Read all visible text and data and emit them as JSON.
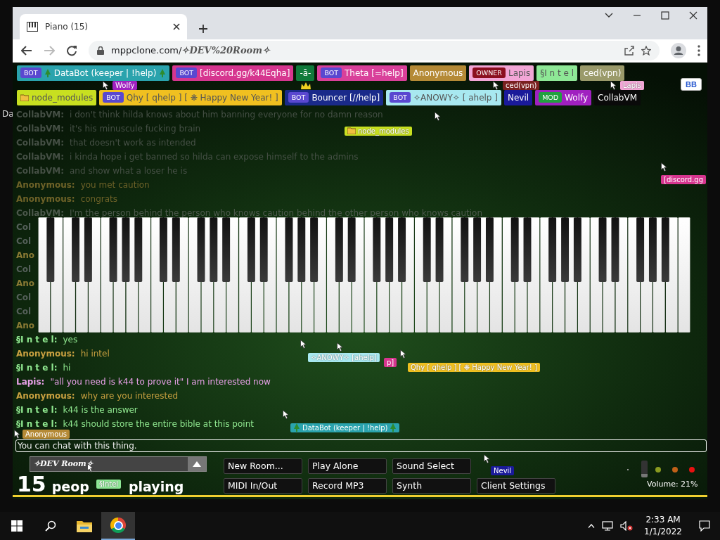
{
  "desktop": {
    "icon_label": "Da"
  },
  "browser": {
    "tab": {
      "title": "Piano (15)",
      "selected": true
    },
    "nav_buttons": [
      {
        "kind": "back",
        "disabled": false
      },
      {
        "kind": "forward",
        "disabled": true
      },
      {
        "kind": "reload",
        "disabled": false
      }
    ],
    "address": {
      "domain": "mppclone.com/",
      "path": "✧DEV%20Room✧"
    }
  },
  "participant_rows": [
    {
      "participants": [
        {
          "kind": "tree",
          "badge": {
            "text": "BOT",
            "color": "#5a48d0"
          },
          "name": "DataBot (keeper | !help)",
          "color": "#2aa3ad"
        },
        {
          "kind": "plain",
          "badge": {
            "text": "BOT",
            "color": "#5a48d0"
          },
          "name": "[discord.gg/k44Eqha]",
          "color": "#d6368f"
        },
        {
          "kind": "plain",
          "name": "-ā-",
          "color": "#0f7a3a"
        },
        {
          "kind": "plain",
          "badge": {
            "text": "BOT",
            "color": "#5a48d0"
          },
          "name": "Theta [=help]",
          "color": "#d9409a"
        },
        {
          "kind": "plain",
          "name": "Anonymous",
          "color": "#b58a36"
        },
        {
          "kind": "plain",
          "badge": {
            "text": "OWNER",
            "color": "#8b0f1f"
          },
          "name": "Lapis",
          "color": "#f2a6d6"
        },
        {
          "kind": "plain",
          "name": "§I n t e l",
          "color": "#8ee896"
        },
        {
          "kind": "plain",
          "name": "ced(vpn)",
          "color": "#9a9a6a"
        }
      ]
    },
    {
      "participants": [
        {
          "kind": "folder",
          "name": "node_modules",
          "color": "#c8e020"
        },
        {
          "kind": "plain",
          "badge": {
            "text": "BOT",
            "color": "#5a48d0"
          },
          "name": "Qhy [ qhelp ] [ ❋ Happy New Year! ]",
          "color": "#f0c020"
        },
        {
          "kind": "plain",
          "badge": {
            "text": "BOT",
            "color": "#5a48d0"
          },
          "name": "Bouncer [//help]",
          "color": "#1a2a8a"
        },
        {
          "kind": "plain",
          "badge": {
            "text": "BOT",
            "color": "#5a48d0"
          },
          "name": "✧ANOWY✧ [ ahelp ]",
          "color": "#a8e8f0"
        },
        {
          "kind": "plain",
          "name": "Nevil",
          "color": "#1a1a9a"
        },
        {
          "kind": "plain",
          "badge": {
            "text": "MOD",
            "color": "#22a040"
          },
          "name": "Wolfy",
          "color": "#a020c0"
        },
        {
          "kind": "plain",
          "name": "CollabVM",
          "color": "#0a0a0a"
        }
      ]
    }
  ],
  "corner_button": {
    "label": "BB"
  },
  "chat": [
    {
      "name": "CollabVM:",
      "text": "i don't think hilda knows about him banning everyone for no damn reason",
      "color": "#465046"
    },
    {
      "name": "CollabVM:",
      "text": "it's his minuscule fucking brain",
      "color": "#465046"
    },
    {
      "name": "CollabVM:",
      "text": "that doesn't work as intended",
      "color": "#465046"
    },
    {
      "name": "CollabVM:",
      "text": "i kinda hope i get banned so hilda can expose himself to the admins",
      "color": "#465046"
    },
    {
      "name": "CollabVM:",
      "text": "and show what a loser he is",
      "color": "#465046"
    },
    {
      "name": "Anonymous:",
      "text": "you met caution",
      "color": "#6e6228"
    },
    {
      "name": "Anonymous:",
      "text": "congrats",
      "color": "#6e6228"
    },
    {
      "name": "CollabVM:",
      "text": "I'm the person behind the person who knows caution behind the other person who knows caution",
      "color": "#4c584c"
    },
    {
      "name": "Col",
      "color": "#55605a"
    },
    {
      "name": "Col",
      "color": "#55605a"
    },
    {
      "name": "Ano",
      "color": "#8a7a34"
    },
    {
      "name": "Col",
      "color": "#55605a"
    },
    {
      "name": "Ano",
      "color": "#8a7a34"
    },
    {
      "name": "Col",
      "color": "#55605a"
    },
    {
      "name": "Col",
      "color": "#55605a"
    },
    {
      "name": "Ano",
      "color": "#8a7a34"
    },
    {
      "name": "§I n t e l:",
      "text": "yes",
      "color": "#90e890"
    },
    {
      "name": "Anonymous:",
      "text": "hi intel",
      "color": "#c8a040"
    },
    {
      "name": "§I n t e l:",
      "text": "hi",
      "color": "#90e890"
    },
    {
      "name": "Lapis:",
      "text": "\"all you need is k44 to prove it\" I am interested now",
      "color": "#e8a0e8"
    },
    {
      "name": "Anonymous:",
      "text": "why are you interested",
      "color": "#c8a040"
    },
    {
      "name": "§I n t e l:",
      "text": "k44 is the answer",
      "color": "#90e890"
    },
    {
      "name": "§I n t e l:",
      "text": "k44 should store the entire bible at this point",
      "color": "#90e890"
    }
  ],
  "cursor_labels": [
    {
      "kind": "plain",
      "text": "Wolfy",
      "color": "#a020c0"
    },
    {
      "kind": "plain",
      "text": "ced(vpn)",
      "color": "#7a2020"
    },
    {
      "kind": "plain",
      "text": "Lapis",
      "color": "#f2a6d6"
    },
    {
      "kind": "folder",
      "text": "node_modules",
      "color": "#c8e020"
    },
    {
      "kind": "plain",
      "text": "[discord.gg",
      "color": "#d6368f"
    },
    {
      "kind": "plain",
      "text": "✧ANOWY✧ [ahelp]",
      "color": "#a8e8f0"
    },
    {
      "kind": "plain",
      "text": "p]",
      "color": "#d6368f"
    },
    {
      "kind": "plain",
      "text": "Qhy [ qhelp ] [ ❋ Happy New Year! ]",
      "color": "#f0c020"
    },
    {
      "kind": "tree",
      "text": "DataBot (keeper | !help)",
      "color": "#2aa3ad"
    },
    {
      "kind": "plain",
      "text": "Anonymous",
      "color": "#b58a36"
    },
    {
      "kind": "plain",
      "text": "Nevil",
      "color": "#1a1a9a"
    },
    {
      "kind": "plain",
      "text": "§Intel",
      "color": "#8ee896"
    }
  ],
  "chat_input": {
    "placeholder": "You can chat with this thing."
  },
  "room_select": {
    "value": "✧DEV Room✧"
  },
  "player_count": {
    "count": "15",
    "text_before": "peop",
    "text_after": "playing"
  },
  "button_rows": [
    [
      "New Room...",
      "Play Alone",
      "Sound Select"
    ],
    [
      "MIDI In/Out",
      "Record MP3",
      "Synth",
      "Client Settings"
    ]
  ],
  "volume": {
    "level": 0.21,
    "label": "Volume: 21%"
  },
  "indicator_lights": [
    {
      "color": "#8a9a20"
    },
    {
      "color": "#c06018"
    },
    {
      "color": "#e81010"
    }
  ],
  "taskbar": {
    "apps": [
      {
        "kind": "explorer",
        "selected": false
      },
      {
        "kind": "chrome",
        "selected": true
      }
    ],
    "clock": {
      "time": "2:33 AM",
      "date": "1/1/2022"
    }
  }
}
